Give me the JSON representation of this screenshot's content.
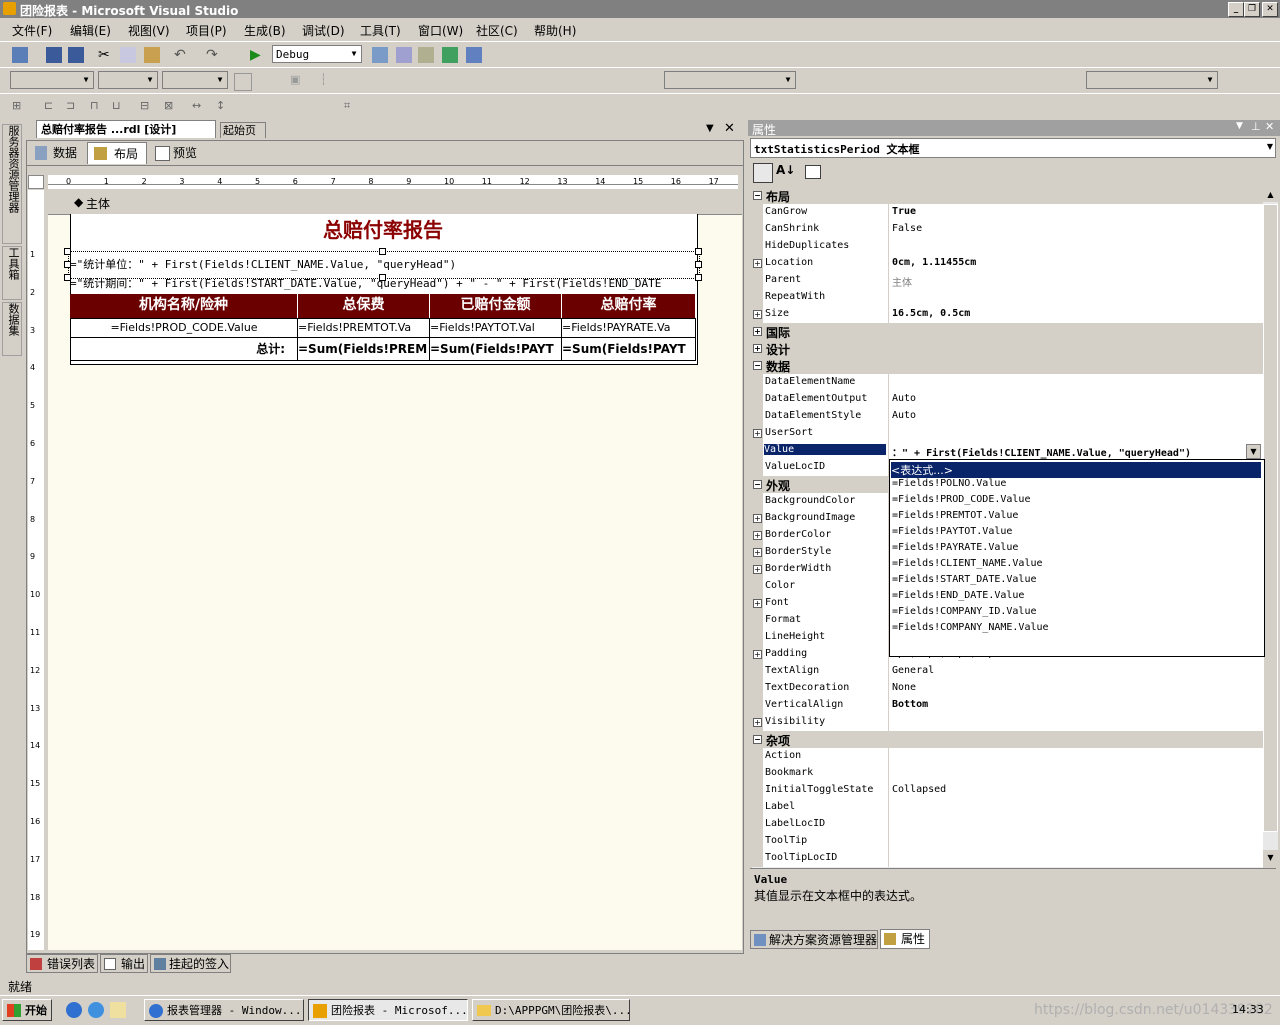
{
  "window": {
    "title": "团险报表 - Microsoft Visual Studio"
  },
  "menu": [
    "文件(F)",
    "编辑(E)",
    "视图(V)",
    "项目(P)",
    "生成(B)",
    "调试(D)",
    "工具(T)",
    "窗口(W)",
    "社区(C)",
    "帮助(H)"
  ],
  "toolbar": {
    "config": "Debug"
  },
  "left_dock": {
    "server_explorer": "服务器资源管理器",
    "toolbox": "工具箱",
    "datasets": "数据集"
  },
  "designer": {
    "doc_tab": "总赔付率报告 ...rdl [设计]",
    "start_tab": "起始页",
    "subtabs": [
      "数据",
      "布局",
      "预览"
    ],
    "body_label": "主体",
    "report_title": "总赔付率报告",
    "line1": "=\"统计单位：\" + First(Fields!CLIENT_NAME.Value, \"queryHead\")",
    "line2": "=\"统计期间：\" + First(Fields!START_DATE.Value, \"queryHead\") + \" - \" + First(Fields!END_DATE",
    "table_headers": [
      "机构名称/险种",
      "总保费",
      "已赔付金额",
      "总赔付率"
    ],
    "table_row": [
      "=Fields!PROD_CODE.Value",
      "=Fields!PREMTOT.Va",
      "=Fields!PAYTOT.Val",
      "=Fields!PAYRATE.Va"
    ],
    "total_row": [
      "总计:",
      "=Sum(Fields!PREM",
      "=Sum(Fields!PAYT",
      "=Sum(Fields!PAYT"
    ],
    "ruler_top": [
      "0",
      "1",
      "2",
      "3",
      "4",
      "5",
      "6",
      "7",
      "8",
      "9",
      "10",
      "11",
      "12",
      "13",
      "14",
      "15",
      "16",
      "17"
    ],
    "ruler_left": [
      "1",
      "2",
      "3",
      "4",
      "5",
      "6",
      "7",
      "8",
      "9",
      "10",
      "11",
      "12",
      "13",
      "14",
      "15",
      "16",
      "17",
      "18",
      "19"
    ]
  },
  "bottom_tabs": [
    "错误列表",
    "输出",
    "挂起的签入"
  ],
  "properties": {
    "title": "属性",
    "object": "txtStatisticsPeriod 文本框",
    "rows": [
      {
        "type": "cat",
        "name": "布局"
      },
      {
        "name": "CanGrow",
        "value": "True",
        "bold": true
      },
      {
        "name": "CanShrink",
        "value": "False"
      },
      {
        "name": "HideDuplicates",
        "value": ""
      },
      {
        "name": "Location",
        "value": "0cm, 1.11455cm",
        "bold": true,
        "exp": true
      },
      {
        "name": "Parent",
        "value": "主体",
        "gray": true
      },
      {
        "name": "RepeatWith",
        "value": ""
      },
      {
        "name": "Size",
        "value": "16.5cm, 0.5cm",
        "bold": true,
        "exp": true
      },
      {
        "type": "cat",
        "name": "国际",
        "collapsed": true
      },
      {
        "type": "cat",
        "name": "设计",
        "collapsed": true
      },
      {
        "type": "cat",
        "name": "数据"
      },
      {
        "name": "DataElementName",
        "value": ""
      },
      {
        "name": "DataElementOutput",
        "value": "Auto"
      },
      {
        "name": "DataElementStyle",
        "value": "Auto"
      },
      {
        "name": "UserSort",
        "value": "",
        "exp": true
      },
      {
        "name": "Value",
        "value": "：\" + First(Fields!CLIENT_NAME.Value, \"queryHead\")",
        "selected": true
      },
      {
        "name": "ValueLocID",
        "value": ""
      },
      {
        "type": "cat",
        "name": "外观"
      },
      {
        "name": "BackgroundColor",
        "value": ""
      },
      {
        "name": "BackgroundImage",
        "value": "",
        "exp": true
      },
      {
        "name": "BorderColor",
        "value": "",
        "exp": true
      },
      {
        "name": "BorderStyle",
        "value": "",
        "exp": true
      },
      {
        "name": "BorderWidth",
        "value": "",
        "exp": true
      },
      {
        "name": "Color",
        "value": ""
      },
      {
        "name": "Font",
        "value": "",
        "exp": true
      },
      {
        "name": "Format",
        "value": ""
      },
      {
        "name": "LineHeight",
        "value": ""
      },
      {
        "name": "Padding",
        "value": "2pt, 2pt, 2pt, 2pt",
        "exp": true
      },
      {
        "name": "TextAlign",
        "value": "General"
      },
      {
        "name": "TextDecoration",
        "value": "None"
      },
      {
        "name": "VerticalAlign",
        "value": "Bottom",
        "bold": true
      },
      {
        "name": "Visibility",
        "value": "",
        "exp": true
      },
      {
        "type": "cat",
        "name": "杂项"
      },
      {
        "name": "Action",
        "value": ""
      },
      {
        "name": "Bookmark",
        "value": ""
      },
      {
        "name": "InitialToggleState",
        "value": "Collapsed"
      },
      {
        "name": "Label",
        "value": ""
      },
      {
        "name": "LabelLocID",
        "value": ""
      },
      {
        "name": "ToolTip",
        "value": ""
      },
      {
        "name": "ToolTipLocID",
        "value": ""
      }
    ],
    "dropdown": [
      "<表达式...>",
      "=Fields!POLNO.Value",
      "=Fields!PROD_CODE.Value",
      "=Fields!PREMTOT.Value",
      "=Fields!PAYTOT.Value",
      "=Fields!PAYRATE.Value",
      "=Fields!CLIENT_NAME.Value",
      "=Fields!START_DATE.Value",
      "=Fields!END_DATE.Value",
      "=Fields!COMPANY_ID.Value",
      "=Fields!COMPANY_NAME.Value"
    ],
    "desc_title": "Value",
    "desc_text": "其值显示在文本框中的表达式。",
    "bottom_tabs": [
      "解决方案资源管理器",
      "属性"
    ]
  },
  "status": "就绪",
  "taskbar": {
    "start": "开始",
    "tasks": [
      "报表管理器 - Window...",
      "团险报表 - Microsof...",
      "D:\\APPPGM\\团险报表\\..."
    ],
    "clock": "14:33",
    "watermark": "https://blog.csdn.net/u014339282"
  }
}
